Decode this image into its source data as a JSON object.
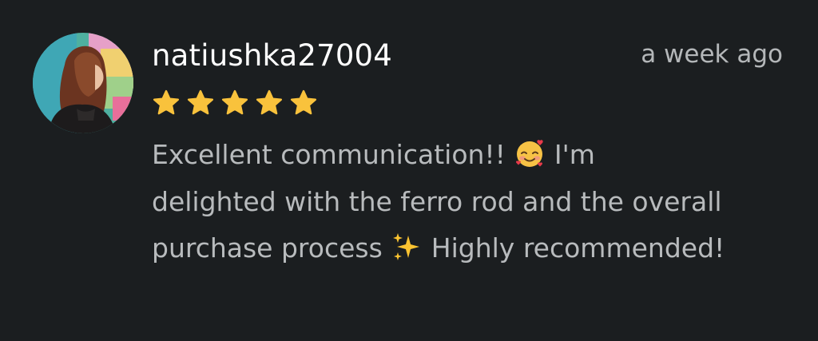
{
  "review": {
    "username": "natiushka27004",
    "timestamp": "a week ago",
    "rating": 5,
    "rating_max": 5,
    "text_part1": "Excellent communication!!",
    "emoji1": "smiling-face-with-hearts",
    "text_part2": "I'm delighted with the ferro rod and the overall purchase process",
    "emoji2": "sparkles",
    "text_part3": "Highly recommended!"
  },
  "colors": {
    "background": "#1b1e20",
    "username": "#ffffff",
    "body_text": "#b8bbbd",
    "timestamp": "#b4b7b9",
    "star": "#f9c23c"
  },
  "icons": {
    "star": "star-icon",
    "avatar": "profile-photo"
  }
}
